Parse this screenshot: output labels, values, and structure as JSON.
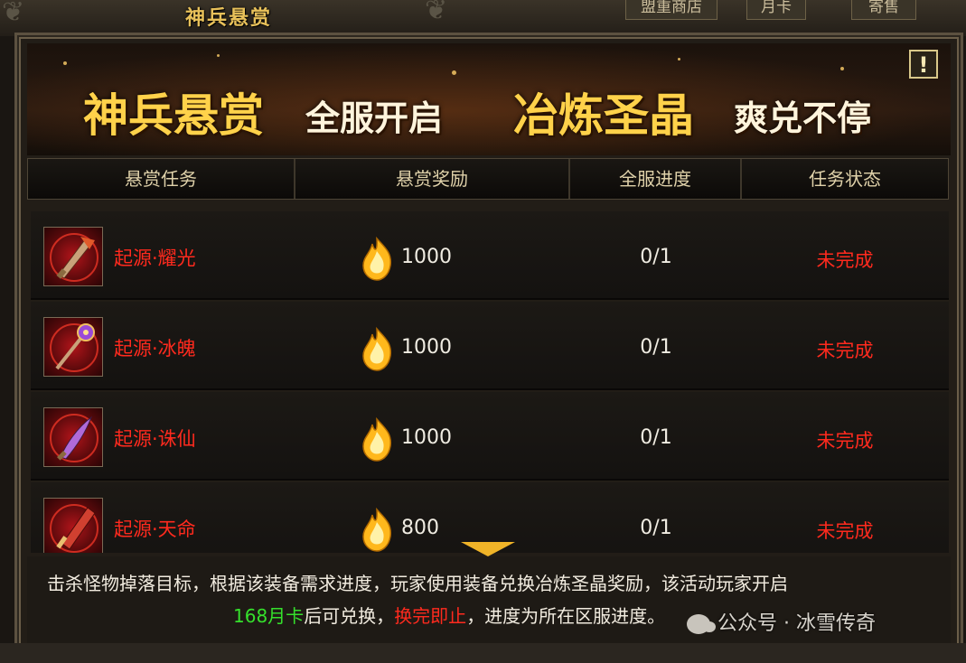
{
  "top": {
    "window_title": "神兵悬赏",
    "tabs": [
      "盟重商店",
      "月卡",
      "寄售"
    ]
  },
  "banner": {
    "part1": "神兵悬赏",
    "part2": "全服开启",
    "part3": "冶炼圣晶",
    "part4": "爽兑不停",
    "info_label": "!"
  },
  "table": {
    "headers": [
      "悬赏任务",
      "悬赏奖励",
      "全服进度",
      "任务状态"
    ],
    "rows": [
      {
        "name": "起源·耀光",
        "reward": "1000",
        "progress": "0/1",
        "status": "未完成"
      },
      {
        "name": "起源·冰魄",
        "reward": "1000",
        "progress": "0/1",
        "status": "未完成"
      },
      {
        "name": "起源·诛仙",
        "reward": "1000",
        "progress": "0/1",
        "status": "未完成"
      },
      {
        "name": "起源·天命",
        "reward": "800",
        "progress": "0/1",
        "status": "未完成"
      }
    ]
  },
  "footer": {
    "line1": "击杀怪物掉落目标，根据该装备需求进度，玩家使用装备兑换冶炼圣晶奖励，该活动玩家开启",
    "line2_green": "168月卡",
    "line2_mid": "后可兑换，",
    "line2_red": "换完即止",
    "line2_end": "，进度为所在区服进度。"
  },
  "watermark": "公众号 · 冰雪传奇",
  "icons": {
    "reward": "gold-flame-crystal-icon",
    "scroll": "chevron-down-icon",
    "info": "exclamation-icon"
  },
  "colors": {
    "status_red": "#ff2a1e",
    "highlight_green": "#35e02c",
    "gold": "#ffd24a"
  }
}
